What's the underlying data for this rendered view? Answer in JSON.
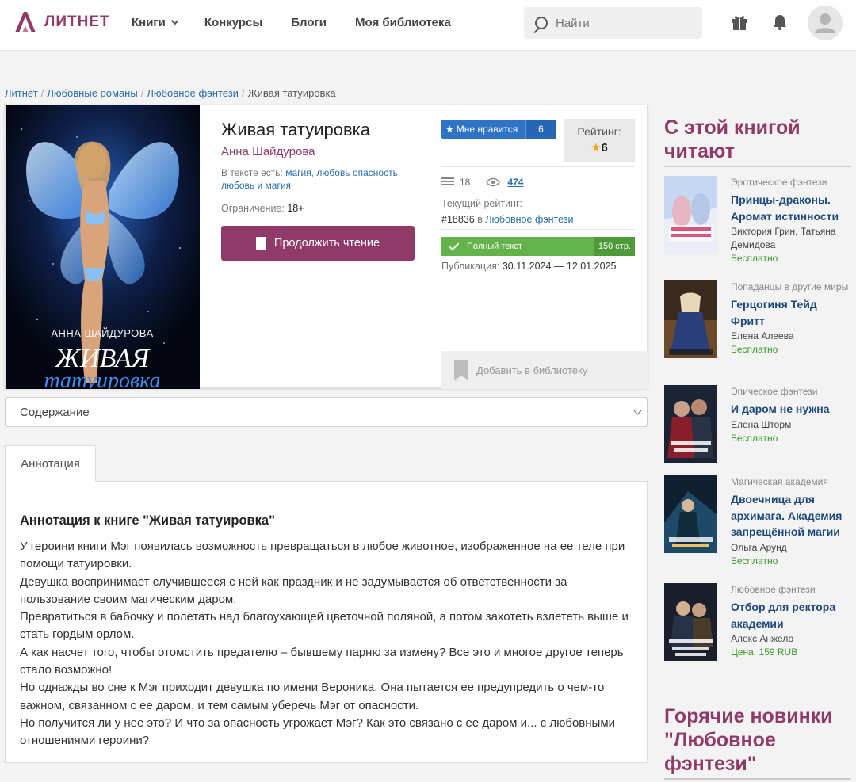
{
  "header": {
    "logo_text": "ЛИТНЕТ",
    "nav": [
      "Книги",
      "Конкурсы",
      "Блоги",
      "Моя библиотека"
    ],
    "search_placeholder": "Найти"
  },
  "breadcrumb": [
    "Литнет",
    "Любовные романы",
    "Любовное фэнтези",
    "Живая татуировка"
  ],
  "book": {
    "title": "Живая татуировка",
    "author": "Анна Шайдурова",
    "tags_label": "В тексте есть:",
    "tags": [
      "магия",
      "любовь",
      "опасность",
      "любовь и магия"
    ],
    "restriction_label": "Ограничение:",
    "restriction": "18+",
    "read_button": "Продолжить чтение",
    "cover_author": "АННА ШАЙДУРОВА",
    "cover_title_1": "ЖИВАЯ",
    "cover_title_2": "татуировка",
    "like_label": "Мне нравится",
    "like_count": "6",
    "rating_label": "Рейтинг:",
    "rating_value": "6",
    "comments": "18",
    "views": "474",
    "current_rating_label": "Текущий рейтинг:",
    "current_rating_num": "#18836",
    "current_rating_in": "в",
    "current_rating_genre": "Любовное фэнтези",
    "full_text_label": "Полный текст",
    "pages": "150 стр.",
    "publication_label": "Публикация:",
    "publication_dates": "30.11.2024 — 12.01.2025",
    "add_library": "Добавить в библиотеку"
  },
  "contents_label": "Содержание",
  "tab_annotation": "Аннотация",
  "annotation": {
    "heading": "Аннотация к книге \"Живая татуировка\"",
    "text": "У героини книги Мэг появилась возможность превращаться в любое животное, изображенное на ее теле при помощи татуировки.\nДевушка воспринимает случившееся с ней как праздник и не задумывается об ответственности за пользование своим магическим даром.\nПревратиться в бабочку и полетать над благоухающей цветочной поляной, а потом захотеть взлететь выше и стать гордым орлом.\nА как насчет того, чтобы отомстить предателю – бывшему парню за измену? Все это и многое другое теперь стало возможно!\nНо однажды во сне к Мэг приходит девушка по имени Вероника. Она пытается ее предупредить о чем-то важном, связанном с ее даром, и тем самым уберечь Мэг от опасности.\nНо получится ли у нее это? И что за опасность угрожает Мэг? Как это связано с ее даром и... с любовными отношениями героини?"
  },
  "sidebar": {
    "heading": "С этой книгой читают",
    "books": [
      {
        "genre": "Эротическое фэнтези",
        "title": "Принцы-драконы. Аромат истинности",
        "author": "Виктория Грин, Татьяна Демидова",
        "price": "Бесплатно",
        "color": "#d9557a"
      },
      {
        "genre": "Попаданцы в другие миры",
        "title": "Герцогиня Тейд Фритт",
        "author": "Елена Алеева",
        "price": "Бесплатно",
        "color": "#2b3f7a"
      },
      {
        "genre": "Эпическое фэнтези",
        "title": "И даром не нужна",
        "author": "Елена Шторм",
        "price": "Бесплатно",
        "color": "#8a1e2a"
      },
      {
        "genre": "Магическая академия",
        "title": "Двоечница для архимага. Академия запрещённой магии",
        "author": "Ольга Арунд",
        "price": "Бесплатно",
        "color": "#1d4a66"
      },
      {
        "genre": "Любовное фэнтези",
        "title": "Отбор для ректора академии",
        "author": "Алекс Анжело",
        "price": "Цена: 159 RUB",
        "color": "#26324a"
      }
    ],
    "heading2": "Горячие новинки \"Любовное фэнтези\""
  }
}
